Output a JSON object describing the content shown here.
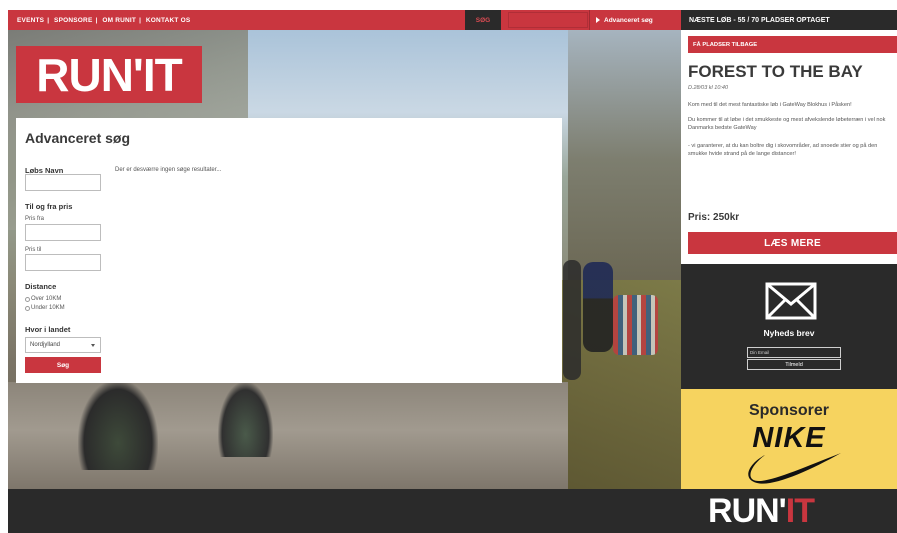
{
  "nav": {
    "items": [
      "EVENTS",
      "SPONSORE",
      "OM RUNIT",
      "KONTAKT OS"
    ],
    "separator": "|",
    "search_toggle": "SØG",
    "advanced_link": "Advanceret søg"
  },
  "logo": {
    "text": "RUN'IT"
  },
  "search_panel": {
    "title": "Advanceret søg",
    "run_name_label": "Løbs Navn",
    "price_label": "Til og fra pris",
    "price_from_label": "Pris fra",
    "price_to_label": "Pris til",
    "distance_label": "Distance",
    "distance_options": [
      "Over 10KM",
      "Under 10KM"
    ],
    "region_label": "Hvor i landet",
    "region_value": "Nordjylland",
    "search_button": "Søg",
    "no_results": "Der er desværre ingen søge resultater..."
  },
  "sidebar": {
    "header": "NÆSTE LØB - 55 / 70 PLADSER OPTAGET",
    "badge": "FÅ PLADSER TILBAGE",
    "event_title": "FOREST TO THE BAY",
    "event_date": "D.28/03 kl 10:40",
    "paragraphs": [
      "Kom med til det mest fantastiske løb i GateWay Blokhus i Påsken!",
      "Du kommer til at løbe i det smukkeste og mest afvekslende løbeterræn i vel nok Danmarks bedste GateWay",
      "- vi garanterer, at du kan boltre dig i skovområder, ad snoede stier og på den smukke hvide strand på de lange distancer!"
    ],
    "price": "Pris: 250kr",
    "read_more": "LÆS MERE",
    "newsletter_title": "Nyheds brev",
    "newsletter_placeholder": "Din Email",
    "newsletter_submit": "Tilmeld",
    "sponsor_title": "Sponsorer",
    "sponsor_brand": "NIKE"
  },
  "footer": {
    "logo_run": "RUN'",
    "logo_it": "IT"
  },
  "colors": {
    "accent": "#c9363f",
    "dark": "#2a2a2a",
    "sponsor_bg": "#f6d35f"
  },
  "icons": {
    "newsletter": "envelope-icon",
    "sponsor": "nike-swoosh-icon",
    "advanced_link": "triangle-right-icon"
  }
}
